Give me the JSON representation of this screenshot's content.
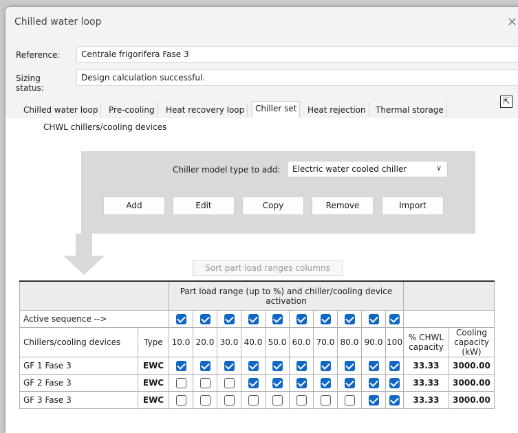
{
  "window": {
    "title": "Chilled water loop"
  },
  "reference": {
    "label": "Reference:",
    "value": "Centrale frigorifera Fase 3"
  },
  "sizing": {
    "label": "Sizing status:",
    "value": "Design calculation successful."
  },
  "tabs": [
    "Chilled water loop",
    "Pre-cooling",
    "Heat recovery loop",
    "Chiller set",
    "Heat rejection",
    "Thermal storage"
  ],
  "active_tab": "Chiller set",
  "section": {
    "title": "CHWL chillers/cooling devices"
  },
  "chiller_type": {
    "label": "Chiller model type to add:",
    "value": "Electric water cooled chiller"
  },
  "buttons": {
    "add": "Add",
    "edit": "Edit",
    "copy": "Copy",
    "remove": "Remove",
    "import": "Import",
    "sort": "Sort part load ranges columns"
  },
  "table": {
    "header_top": "Part load range (up to %) and chiller/cooling device activation",
    "active_sequence_label": "Active sequence  -->",
    "col_devices": "Chillers/cooling devices",
    "col_type": "Type",
    "col_pct": "% CHWL capacity",
    "col_cap": "Cooling capacity (kW)",
    "ranges": [
      "10.0",
      "20.0",
      "30.0",
      "40.0",
      "50.0",
      "60.0",
      "70.0",
      "80.0",
      "90.0",
      "100"
    ],
    "active_sequence": [
      true,
      true,
      true,
      true,
      true,
      true,
      true,
      true,
      true,
      true
    ],
    "rows": [
      {
        "name": "GF 1 Fase 3",
        "type": "EWC",
        "activation": [
          true,
          true,
          true,
          true,
          true,
          true,
          true,
          true,
          true,
          true
        ],
        "pct": "33.33",
        "cap": "3000.00"
      },
      {
        "name": "GF 2 Fase 3",
        "type": "EWC",
        "activation": [
          false,
          false,
          false,
          true,
          true,
          true,
          true,
          true,
          true,
          true
        ],
        "pct": "33.33",
        "cap": "3000.00"
      },
      {
        "name": "GF 3 Fase 3",
        "type": "EWC",
        "activation": [
          false,
          false,
          false,
          false,
          false,
          false,
          false,
          false,
          true,
          true
        ],
        "pct": "33.33",
        "cap": "3000.00"
      }
    ]
  }
}
